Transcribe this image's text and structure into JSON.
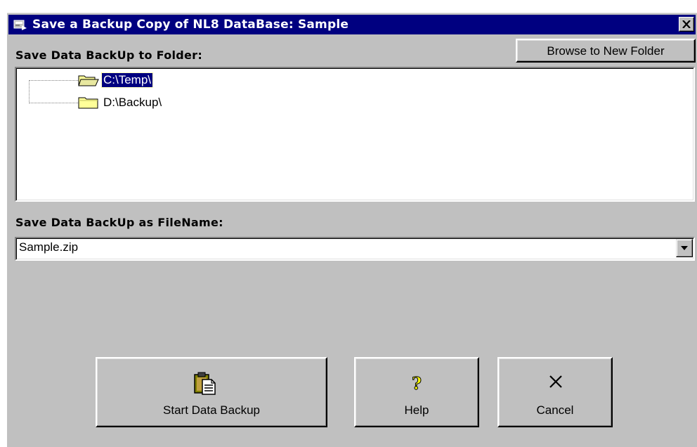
{
  "window": {
    "title": "Save a Backup Copy of NL8 DataBase: Sample",
    "title_icon": "app-icon",
    "close_icon": "close-icon",
    "colors": {
      "titlebar": "#000080",
      "face": "#c0c0c0",
      "selection": "#000080"
    }
  },
  "folder_section": {
    "label": "Save Data BackUp to Folder:",
    "browse_button_label": "Browse to New Folder",
    "folders": [
      {
        "path": "C:\\Temp\\",
        "selected": true,
        "icon": "open-folder-icon"
      },
      {
        "path": "D:\\Backup\\",
        "selected": false,
        "icon": "folder-icon"
      }
    ]
  },
  "filename_section": {
    "label": "Save Data BackUp as FileName:",
    "value": "Sample.zip",
    "dropdown_icon": "chevron-down-icon"
  },
  "actions": {
    "start": {
      "label": "Start Data Backup",
      "icon": "clipboard-document-icon"
    },
    "help": {
      "label": "Help",
      "icon": "question-mark-icon"
    },
    "cancel": {
      "label": "Cancel",
      "icon": "x-icon"
    }
  }
}
